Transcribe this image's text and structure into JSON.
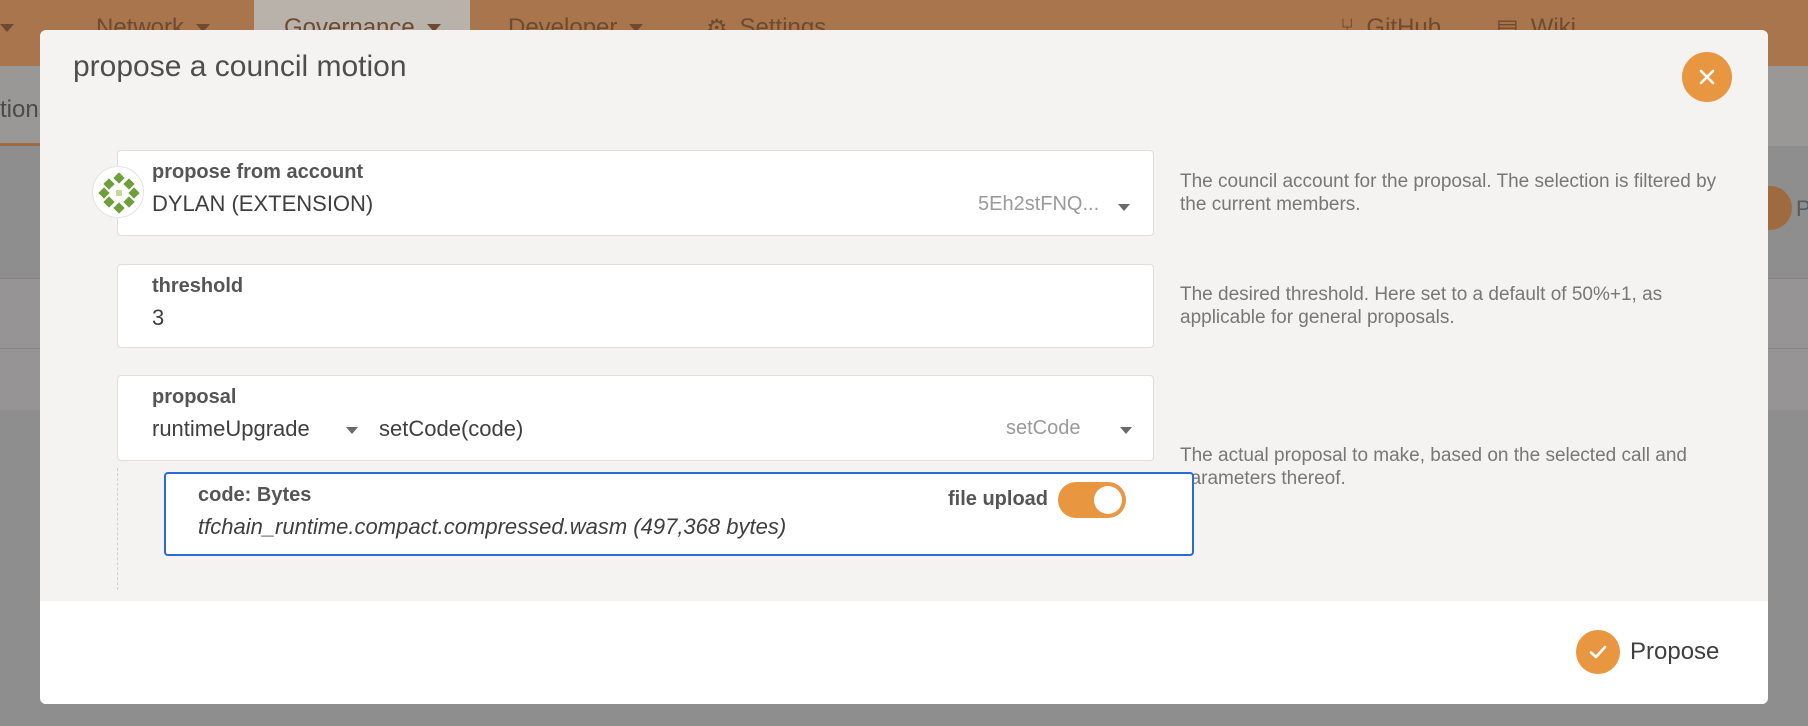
{
  "background": {
    "nav": [
      {
        "label": "Network"
      },
      {
        "label": "Governance"
      },
      {
        "label": "Developer"
      },
      {
        "label": "Settings"
      },
      {
        "label": "GitHub"
      },
      {
        "label": "Wiki"
      }
    ],
    "sub_tab_fragment": "tions",
    "right_fragment": "P"
  },
  "modal": {
    "title": "propose a council motion",
    "account": {
      "label": "propose from account",
      "value": "DYLAN (EXTENSION)",
      "address": "5Eh2stFNQ...",
      "help": "The council account for the proposal. The selection is filtered by the current members."
    },
    "threshold": {
      "label": "threshold",
      "value": "3",
      "help": "The desired threshold. Here set to a default of 50%+1, as applicable for general proposals."
    },
    "proposal": {
      "label": "proposal",
      "module": "runtimeUpgrade",
      "call": "setCode(code)",
      "call_short": "setCode",
      "help": "The actual proposal to make, based on the selected call and parameters thereof."
    },
    "code": {
      "label": "code: Bytes",
      "value": "tfchain_runtime.compact.compressed.wasm (497,368 bytes)",
      "file_upload_label": "file upload",
      "file_upload_on": true
    },
    "propose_label": "Propose"
  },
  "colors": {
    "accent": "#e8963f",
    "focus_border": "#2a6bd6"
  }
}
